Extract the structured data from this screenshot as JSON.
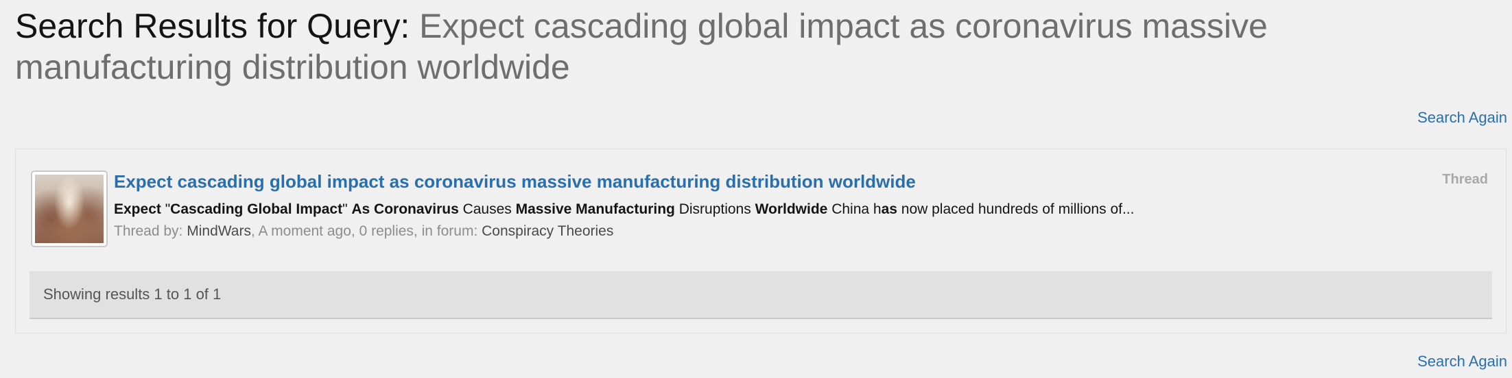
{
  "header": {
    "title_prefix": "Search Results for Query:",
    "query": "Expect cascading global impact as coronavirus massive manufacturing distribution worldwide"
  },
  "search_again_label": "Search Again",
  "results": [
    {
      "title": "Expect cascading global impact as coronavirus massive manufacturing distribution worldwide",
      "type": "Thread",
      "snippet": {
        "s1": "Expect",
        "s2": " \"",
        "s3": "Cascading Global Impact",
        "s4": "\" ",
        "s5": "As Coronavirus",
        "s6": " Causes ",
        "s7": "Massive Manufacturing",
        "s8": " Disruptions ",
        "s9": "Worldwide",
        "s10": " China h",
        "s11": "as",
        "s12": " now placed hundreds of millions of..."
      },
      "meta": {
        "thread_by_label": "Thread by: ",
        "author": "MindWars",
        "details": ", A moment ago, 0 replies, in forum: ",
        "forum": "Conspiracy Theories"
      }
    }
  ],
  "pagination": {
    "text": "Showing results 1 to 1 of 1"
  }
}
